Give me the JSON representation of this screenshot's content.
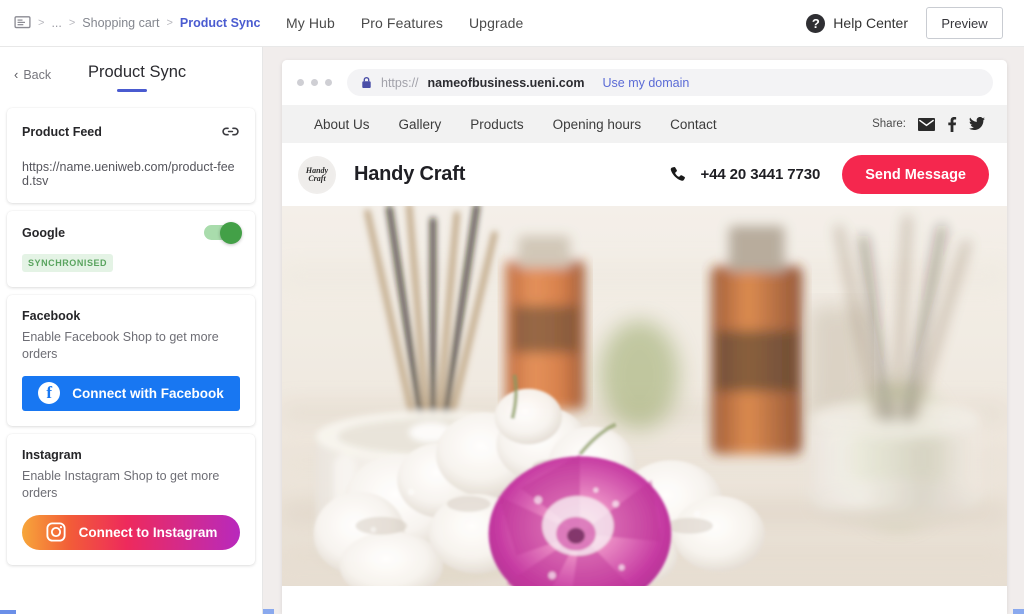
{
  "breadcrumb": {
    "icon": "monitor-icon",
    "ellipsis": "...",
    "separator": ">",
    "items": [
      {
        "label": "Shopping cart",
        "active": false
      },
      {
        "label": "Product Sync",
        "active": true
      }
    ]
  },
  "topnav": {
    "items": [
      {
        "label": "My Hub"
      },
      {
        "label": "Pro Features"
      },
      {
        "label": "Upgrade"
      }
    ],
    "help_center": "Help Center",
    "help_icon": "question-mark-circle-icon",
    "preview_button": "Preview"
  },
  "sidebar": {
    "back_label": "Back",
    "back_icon": "chevron-left-icon",
    "title": "Product Sync",
    "cards": [
      {
        "id": "product-feed",
        "title": "Product Feed",
        "icon": "link-icon",
        "url": "https://name.ueniweb.com/product-feed.tsv"
      },
      {
        "id": "google",
        "title": "Google",
        "toggle_on": true,
        "status_badge": "SYNCHRONISED"
      },
      {
        "id": "facebook",
        "title": "Facebook",
        "subtitle": "Enable Facebook Shop to get more orders",
        "button_label": "Connect with Facebook",
        "button_icon": "facebook-icon",
        "button_color": "#1877f2"
      },
      {
        "id": "instagram",
        "title": "Instagram",
        "subtitle": "Enable Instagram Shop to get more orders",
        "button_label": "Connect to Instagram",
        "button_icon": "instagram-icon",
        "button_color": "#ee2a5c"
      }
    ]
  },
  "preview": {
    "address_bar": {
      "lock_icon": "lock-icon",
      "url_scheme": "https://",
      "url_host": "nameofbusiness.ueni.com",
      "use_my_domain": "Use my domain"
    },
    "site_nav": {
      "links": [
        {
          "label": "About Us"
        },
        {
          "label": "Gallery"
        },
        {
          "label": "Products"
        },
        {
          "label": "Opening hours"
        },
        {
          "label": "Contact"
        }
      ],
      "share_label": "Share:",
      "share_icons": [
        "email-icon",
        "facebook-icon",
        "twitter-icon"
      ]
    },
    "business": {
      "logo_text": "Handy Craft",
      "name": "Handy Craft",
      "phone_icon": "phone-icon",
      "phone": "+44 20 3441 7730",
      "cta_label": "Send Message",
      "cta_color": "#f5274e"
    },
    "hero_alt": "reed diffuser bottles and white and pink carnation flowers on light wood"
  },
  "colors": {
    "accent_blue": "#4a5bd0",
    "green": "#43a047",
    "badge_bg": "#e4f3e5",
    "badge_text": "#5aa45f",
    "facebook": "#1877f2",
    "crimson": "#f5274e"
  }
}
